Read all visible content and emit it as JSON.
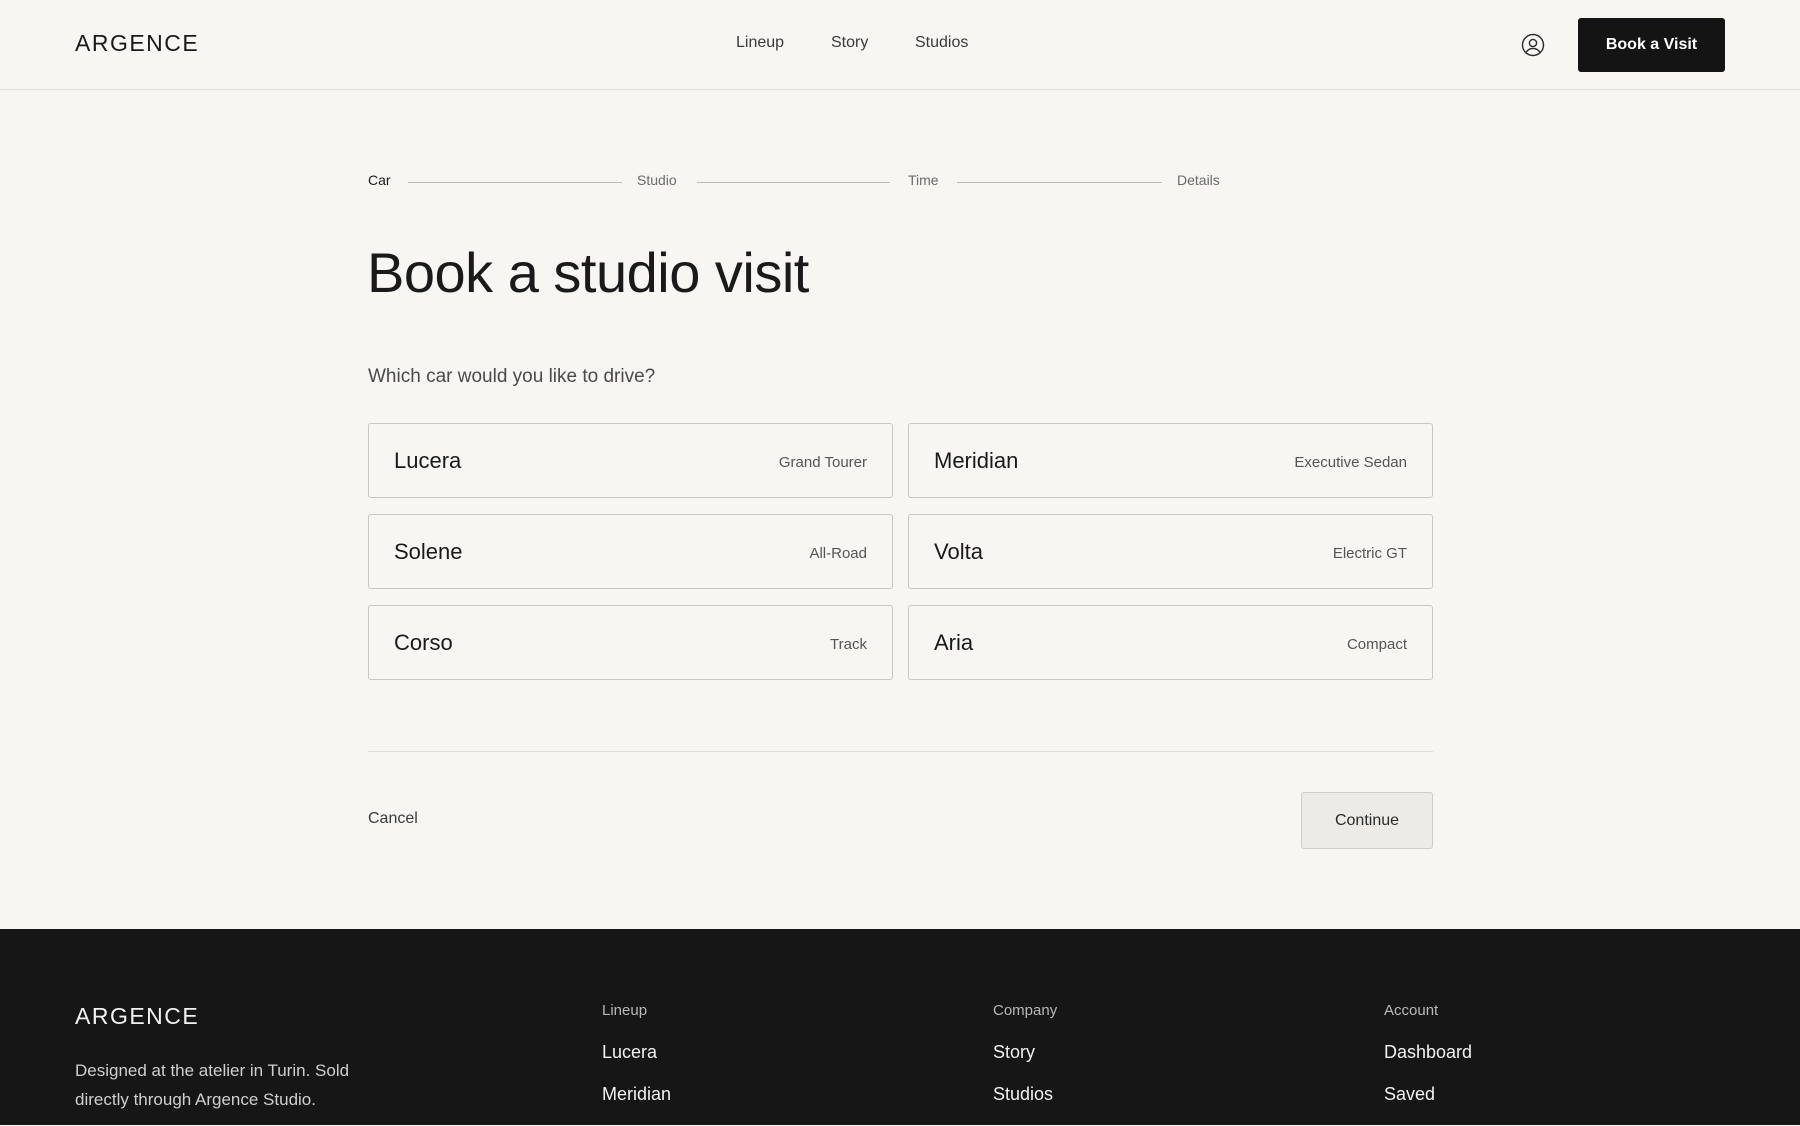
{
  "header": {
    "logo": "ARGENCE",
    "nav": [
      "Lineup",
      "Story",
      "Studios"
    ],
    "book_label": "Book a Visit",
    "user_icon": "user-circle-icon"
  },
  "stepper": {
    "steps": [
      "Car",
      "Studio",
      "Time",
      "Details"
    ],
    "current_step": "Car"
  },
  "main": {
    "title": "Book a studio visit",
    "question": "Which car would you like to drive?",
    "cars": [
      {
        "name": "Lucera",
        "class": "Grand Tourer"
      },
      {
        "name": "Meridian",
        "class": "Executive Sedan"
      },
      {
        "name": "Solene",
        "class": "All-Road"
      },
      {
        "name": "Volta",
        "class": "Electric GT"
      },
      {
        "name": "Corso",
        "class": "Track"
      },
      {
        "name": "Aria",
        "class": "Compact"
      }
    ],
    "cancel_label": "Cancel",
    "continue_label": "Continue"
  },
  "footer": {
    "logo": "ARGENCE",
    "description": "Designed at the atelier in Turin. Sold directly through Argence Studio.",
    "columns": [
      {
        "heading": "Lineup",
        "links": [
          "Lucera",
          "Meridian"
        ]
      },
      {
        "heading": "Company",
        "links": [
          "Story",
          "Studios"
        ]
      },
      {
        "heading": "Account",
        "links": [
          "Dashboard",
          "Saved"
        ]
      }
    ]
  },
  "colors": {
    "background": "#f7f6f3",
    "primary_button": "#141414",
    "footer": "#161616"
  }
}
